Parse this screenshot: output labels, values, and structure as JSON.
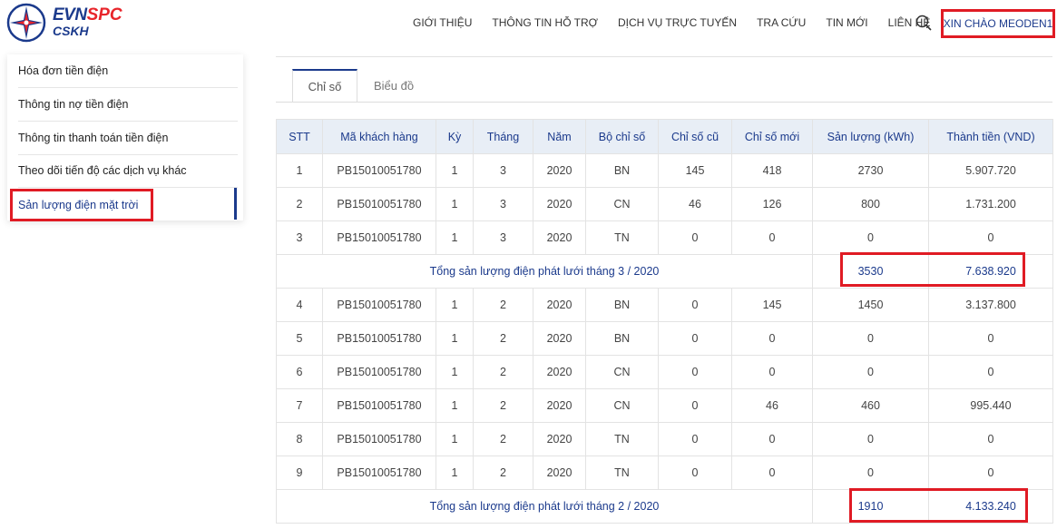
{
  "brand": {
    "evn": "EVN",
    "spc": "SPC",
    "cskh": "CSKH"
  },
  "nav": [
    "GIỚI THIỆU",
    "THÔNG TIN HỖ TRỢ",
    "DỊCH VỤ TRỰC TUYẾN",
    "TRA CỨU",
    "TIN MỚI",
    "LIÊN HỆ"
  ],
  "greeting": "XIN CHÀO MEODEN1",
  "sidebar": {
    "items": [
      {
        "label": "Hóa đơn tiền điện"
      },
      {
        "label": "Thông tin nợ tiền điện"
      },
      {
        "label": "Thông tin thanh toán tiền điện"
      },
      {
        "label": "Theo dõi tiến độ các dịch vụ khác"
      },
      {
        "label": "Sản lượng điện mặt trời"
      }
    ]
  },
  "tabs": {
    "active": "Chỉ số",
    "inactive": "Biểu đồ"
  },
  "table": {
    "headers": [
      "STT",
      "Mã khách hàng",
      "Kỳ",
      "Tháng",
      "Năm",
      "Bộ chỉ số",
      "Chỉ số cũ",
      "Chỉ số mới",
      "Sản lượng (kWh)",
      "Thành tiền (VND)"
    ],
    "rows": [
      [
        "1",
        "PB15010051780",
        "1",
        "3",
        "2020",
        "BN",
        "145",
        "418",
        "2730",
        "5.907.720"
      ],
      [
        "2",
        "PB15010051780",
        "1",
        "3",
        "2020",
        "CN",
        "46",
        "126",
        "800",
        "1.731.200"
      ],
      [
        "3",
        "PB15010051780",
        "1",
        "3",
        "2020",
        "TN",
        "0",
        "0",
        "0",
        "0"
      ],
      {
        "total": true,
        "label": "Tổng sản lượng điện phát lưới tháng 3 / 2020",
        "kwh": "3530",
        "amount": "7.638.920"
      },
      [
        "4",
        "PB15010051780",
        "1",
        "2",
        "2020",
        "BN",
        "0",
        "145",
        "1450",
        "3.137.800"
      ],
      [
        "5",
        "PB15010051780",
        "1",
        "2",
        "2020",
        "BN",
        "0",
        "0",
        "0",
        "0"
      ],
      [
        "6",
        "PB15010051780",
        "1",
        "2",
        "2020",
        "CN",
        "0",
        "0",
        "0",
        "0"
      ],
      [
        "7",
        "PB15010051780",
        "1",
        "2",
        "2020",
        "CN",
        "0",
        "46",
        "460",
        "995.440"
      ],
      [
        "8",
        "PB15010051780",
        "1",
        "2",
        "2020",
        "TN",
        "0",
        "0",
        "0",
        "0"
      ],
      [
        "9",
        "PB15010051780",
        "1",
        "2",
        "2020",
        "TN",
        "0",
        "0",
        "0",
        "0"
      ],
      {
        "total": true,
        "label": "Tổng sản lượng điện phát lưới tháng 2 / 2020",
        "kwh": "1910",
        "amount": "4.133.240"
      }
    ]
  },
  "colors": {
    "brand_blue": "#1b3a8c",
    "brand_red": "#e8252b",
    "highlight": "#e01b24",
    "header_bg": "#e8eef6"
  }
}
